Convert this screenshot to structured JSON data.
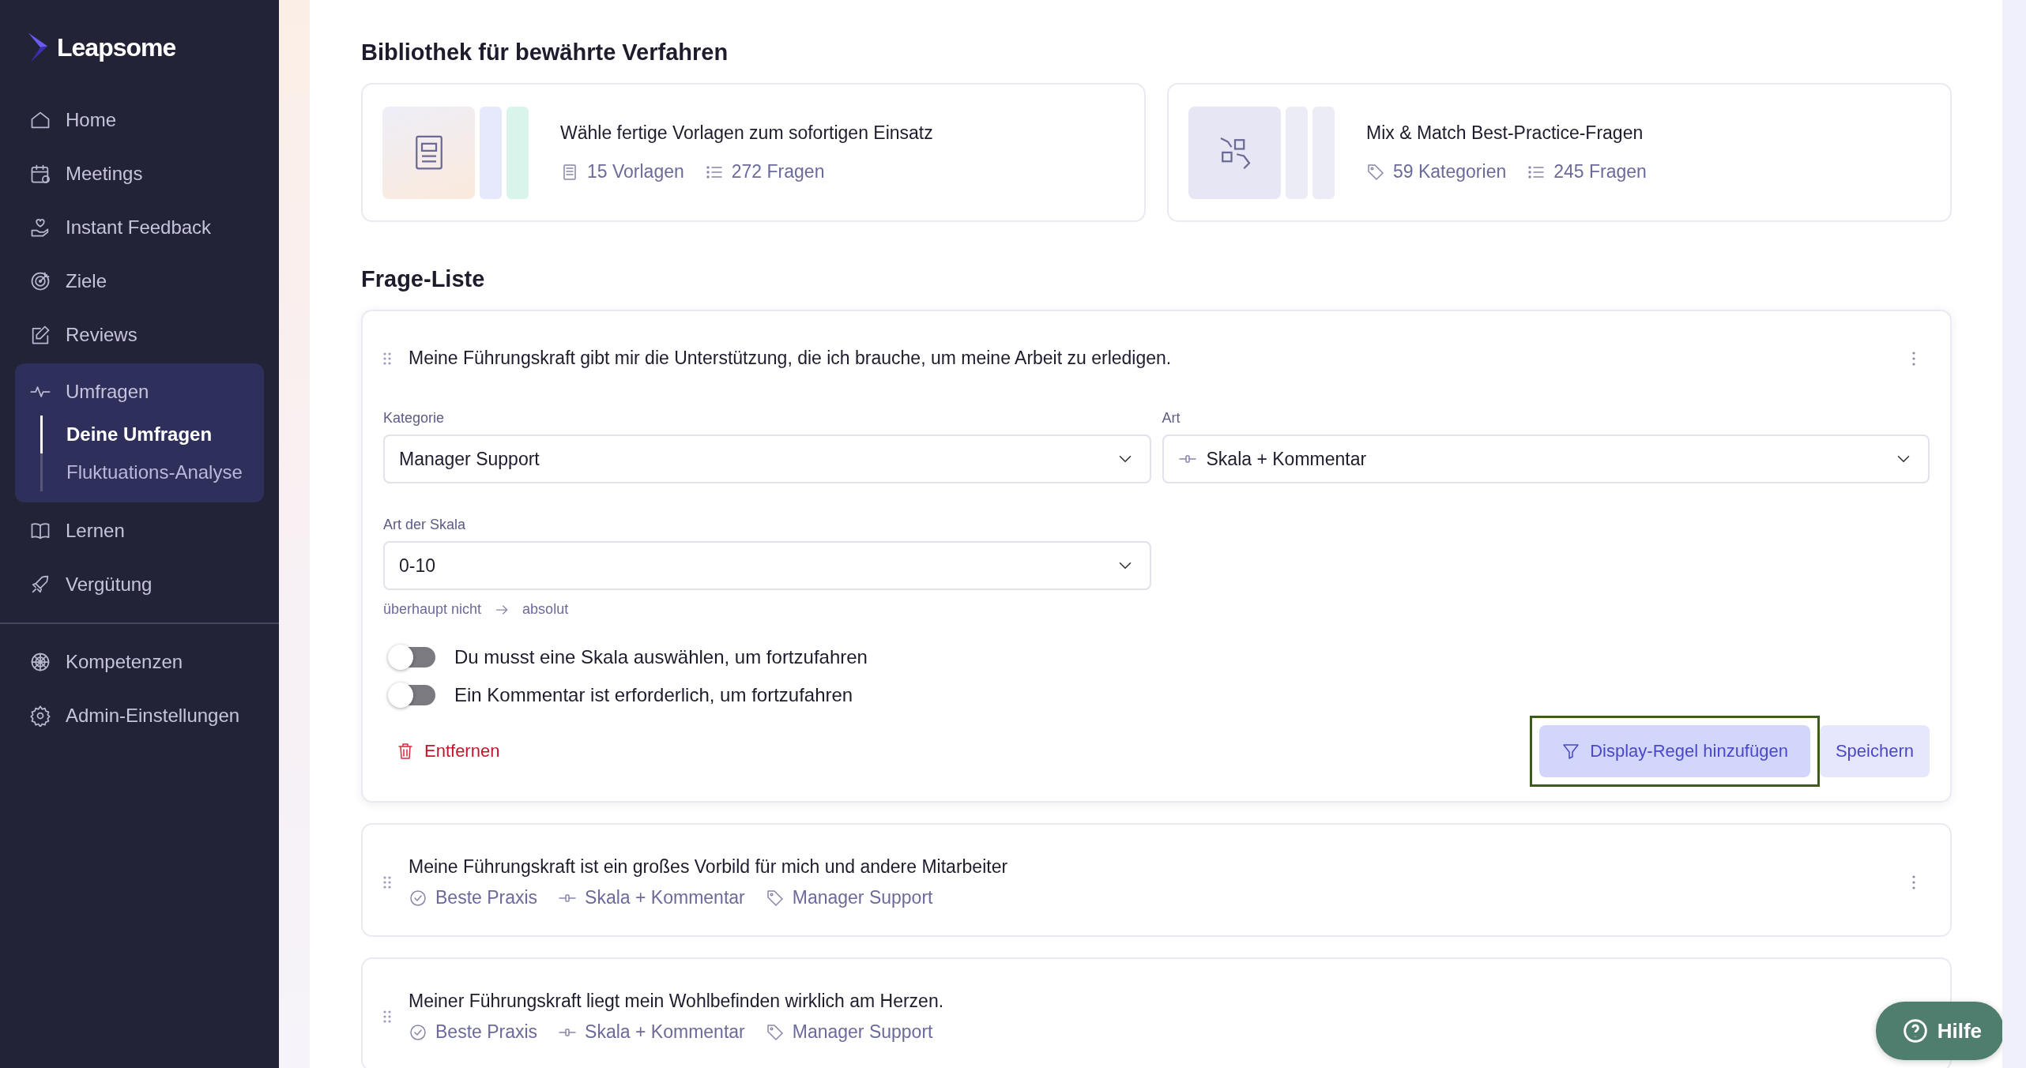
{
  "sidebar": {
    "logo": "Leapsome",
    "items": [
      {
        "label": "Home",
        "kind": "link"
      },
      {
        "label": "Meetings",
        "kind": "link"
      },
      {
        "label": "Instant Feedback",
        "kind": "link"
      },
      {
        "label": "Ziele",
        "kind": "link"
      },
      {
        "label": "Reviews",
        "kind": "link"
      },
      {
        "label": "Umfragen",
        "kind": "group",
        "expanded": true,
        "children": [
          {
            "label": "Deine Umfragen",
            "selected": true
          },
          {
            "label": "Fluktuations-Analyse",
            "selected": false
          }
        ]
      },
      {
        "label": "Lernen",
        "kind": "link"
      },
      {
        "label": "Vergütung",
        "kind": "link"
      }
    ],
    "bottom_items": [
      {
        "label": "Kompetenzen"
      },
      {
        "label": "Admin-Einstellungen"
      }
    ]
  },
  "library": {
    "title": "Bibliothek für bewährte Verfahren",
    "cards": [
      {
        "title": "Wähle fertige Vorlagen zum sofortigen Einsatz",
        "meta": [
          "15 Vorlagen",
          "272 Fragen"
        ]
      },
      {
        "title": "Mix & Match Best-Practice-Fragen",
        "meta": [
          "59 Kategorien",
          "245 Fragen"
        ]
      }
    ]
  },
  "question_list": {
    "title": "Frage-Liste",
    "expanded_question": {
      "text": "Meine Führungskraft gibt mir die Unterstützung, die ich brauche, um meine Arbeit zu erledigen.",
      "category": {
        "label": "Kategorie",
        "value": "Manager Support"
      },
      "type": {
        "label": "Art",
        "value": "Skala + Kommentar"
      },
      "scale": {
        "label": "Art der Skala",
        "value": "0-10",
        "from": "überhaupt nicht",
        "to": "absolut"
      },
      "toggles": [
        {
          "label": "Du musst eine Skala auswählen, um fortzufahren",
          "on": false
        },
        {
          "label": "Ein Kommentar ist erforderlich, um fortzufahren",
          "on": false
        }
      ],
      "remove": "Entfernen",
      "add_rule": {
        "label": "Display-Regel hinzufügen",
        "focused": true
      },
      "save": "Speichern"
    },
    "questions": [
      {
        "text": "Meine Führungskraft ist ein großes Vorbild für mich und andere Mitarbeiter",
        "tags": [
          "Beste Praxis",
          "Skala + Kommentar",
          "Manager Support"
        ]
      },
      {
        "text": "Meiner Führungskraft liegt mein Wohlbefinden wirklich am Herzen.",
        "tags": [
          "Beste Praxis",
          "Skala + Kommentar",
          "Manager Support"
        ]
      }
    ]
  },
  "help_button": "Hilfe"
}
